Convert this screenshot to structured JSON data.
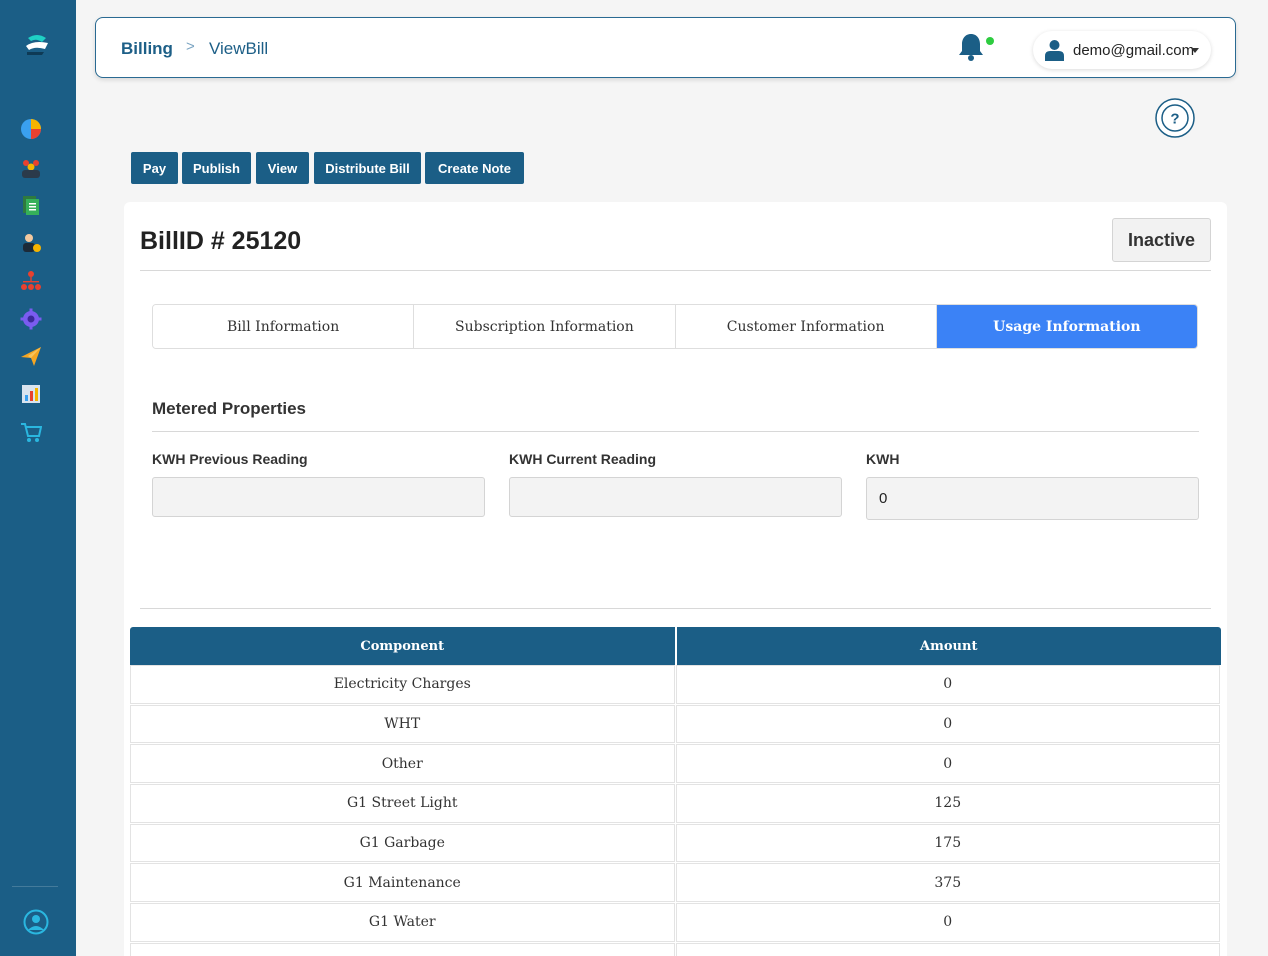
{
  "breadcrumb": {
    "root": "Billing",
    "separator": ">",
    "current": "ViewBill"
  },
  "user": {
    "email": "demo@gmail.com"
  },
  "actions": [
    "Pay",
    "Publish",
    "View",
    "Distribute Bill",
    "Create Note"
  ],
  "bill": {
    "title": "BillID # 25120",
    "status": "Inactive"
  },
  "tabs": [
    {
      "label": "Bill Information",
      "active": false
    },
    {
      "label": "Subscription Information",
      "active": false
    },
    {
      "label": "Customer Information",
      "active": false
    },
    {
      "label": "Usage Information",
      "active": true
    }
  ],
  "metered": {
    "title": "Metered Properties",
    "fields": [
      {
        "label": "KWH Previous Reading",
        "value": ""
      },
      {
        "label": "KWH Current Reading",
        "value": ""
      },
      {
        "label": "KWH",
        "value": "0"
      }
    ]
  },
  "table": {
    "headers": [
      "Component",
      "Amount"
    ],
    "rows": [
      [
        "Electricity Charges",
        "0"
      ],
      [
        "WHT",
        "0"
      ],
      [
        "Other",
        "0"
      ],
      [
        "G1 Street Light",
        "125"
      ],
      [
        "G1 Garbage",
        "175"
      ],
      [
        "G1 Maintenance",
        "375"
      ],
      [
        "G1 Water",
        "0"
      ],
      [
        "",
        ""
      ]
    ]
  },
  "sidebar": {
    "icons": [
      "analytics-icon",
      "customers-icon",
      "documents-icon",
      "user-billing-icon",
      "hierarchy-icon",
      "settings-icon",
      "send-icon",
      "reports-icon",
      "cart-icon"
    ]
  },
  "colors": {
    "primary": "#1b5e86",
    "active_tab": "#3b82f6",
    "notification": "#2ecc40"
  }
}
